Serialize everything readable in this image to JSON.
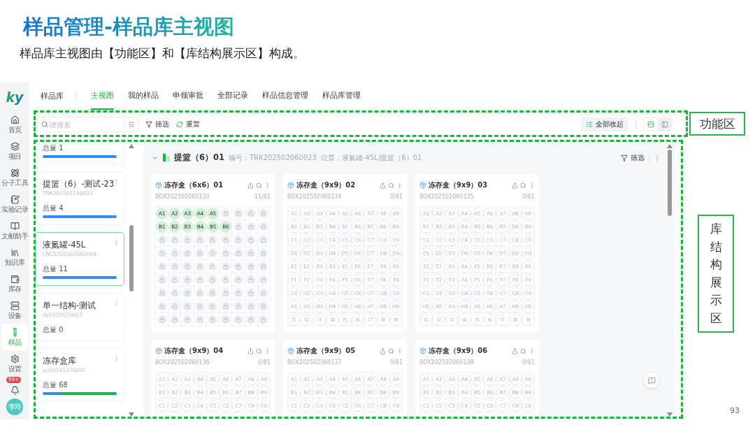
{
  "slide": {
    "title": "样品管理-样品库主视图",
    "subtitle": "样品库主视图由【功能区】和【库结构展示区】构成。",
    "page_number": "93"
  },
  "annotations": [
    {
      "label": "功能区",
      "kind": "horizontal"
    },
    {
      "label": "库结构展示区",
      "kind": "vertical"
    }
  ],
  "nav": {
    "logo": "ky",
    "items": [
      {
        "label": "首页",
        "selected": false
      },
      {
        "label": "项目",
        "selected": false
      },
      {
        "label": "分子工具",
        "selected": false
      },
      {
        "label": "实验记录",
        "selected": false
      },
      {
        "label": "文献助手",
        "selected": false
      },
      {
        "label": "知识库",
        "selected": false
      },
      {
        "label": "库存",
        "selected": false
      },
      {
        "label": "设备",
        "selected": false
      },
      {
        "label": "样品",
        "selected": true
      },
      {
        "label": "设置",
        "selected": false
      }
    ],
    "notification_badge": "99+",
    "avatar": "李玲"
  },
  "module_title": "样品库",
  "tabs": [
    {
      "label": "主视图",
      "selected": true
    },
    {
      "label": "我的样品",
      "selected": false
    },
    {
      "label": "申领审批",
      "selected": false
    },
    {
      "label": "全部记录",
      "selected": false
    },
    {
      "label": "样品信息管理",
      "selected": false
    },
    {
      "label": "样品库管理",
      "selected": false
    }
  ],
  "toolbar": {
    "search_placeholder": "请搜索",
    "filter": "筛选",
    "reset": "重置",
    "collapse_all": "全部收起",
    "views": [
      {
        "selected": true
      },
      {
        "selected": false
      }
    ]
  },
  "library_list": [
    {
      "total": "总量 1",
      "selected": false,
      "segments": [
        {
          "level": 1,
          "color": "#2f8ef5"
        }
      ]
    },
    {
      "name": "提篮（6）-测试-23",
      "code": "TRK202501230022",
      "total": "总量 4",
      "selected": false,
      "segments": [
        {
          "level": 1,
          "color": "#2f8ef5"
        }
      ]
    },
    {
      "name": "液氮罐-45L",
      "code": "LNCS202502060004",
      "total": "总量 11",
      "selected": true,
      "segments": [
        {
          "level": 1,
          "color": "#2f8ef5"
        }
      ]
    },
    {
      "name": "单一结构-测试",
      "code": "dy2025020615",
      "total": "总量 0",
      "selected": false
    },
    {
      "name": "冻存盒库",
      "code": "yp20241226002",
      "total": "总量 68",
      "selected": false,
      "segments": [
        {
          "level": 0.25,
          "color": "#2f8ef5"
        },
        {
          "level": 0.75,
          "color": "#1db34a"
        }
      ]
    }
  ],
  "basket": {
    "expanded": true,
    "title": "提篮（6）01",
    "code": "编号：TRK202502060023",
    "location": "位置：液氮罐-45L/提篮（6）01",
    "filter": "筛选"
  },
  "boxes": [
    {
      "title": "冻存盒（6x6）01",
      "code": "BOX202502060133",
      "count": "11/81",
      "rows": [
        [
          {
            "label": "A1",
            "kind": "occupied"
          },
          {
            "label": "A2",
            "kind": "occupied"
          },
          {
            "label": "A3",
            "kind": "occupied"
          },
          {
            "label": "A4",
            "kind": "occupied"
          },
          {
            "label": "A5",
            "kind": "occupied"
          },
          {
            "kind": "locked"
          },
          {
            "kind": "locked"
          },
          {
            "kind": "locked"
          },
          {
            "kind": "locked"
          }
        ],
        [
          {
            "label": "B1",
            "kind": "occupied"
          },
          {
            "label": "B2",
            "kind": "occupied"
          },
          {
            "label": "B3",
            "kind": "occupied"
          },
          {
            "label": "B4",
            "kind": "occupied"
          },
          {
            "label": "B5",
            "kind": "occupied"
          },
          {
            "label": "B6",
            "kind": "occupied"
          },
          {
            "kind": "locked"
          },
          {
            "kind": "locked"
          },
          {
            "kind": "locked"
          }
        ],
        [
          {
            "kind": "locked"
          },
          {
            "kind": "locked"
          },
          {
            "kind": "locked"
          },
          {
            "kind": "locked"
          },
          {
            "kind": "locked"
          },
          {
            "kind": "locked"
          },
          {
            "kind": "locked"
          },
          {
            "kind": "locked"
          },
          {
            "kind": "locked"
          }
        ],
        [
          {
            "kind": "locked"
          },
          {
            "kind": "locked"
          },
          {
            "kind": "locked"
          },
          {
            "kind": "locked"
          },
          {
            "kind": "locked"
          },
          {
            "kind": "locked"
          },
          {
            "kind": "locked"
          },
          {
            "kind": "locked"
          },
          {
            "kind": "locked"
          }
        ],
        [
          {
            "kind": "locked"
          },
          {
            "kind": "locked"
          },
          {
            "kind": "locked"
          },
          {
            "kind": "locked"
          },
          {
            "kind": "locked"
          },
          {
            "kind": "locked"
          },
          {
            "kind": "locked"
          },
          {
            "kind": "locked"
          },
          {
            "kind": "locked"
          }
        ],
        [
          {
            "kind": "locked"
          },
          {
            "kind": "locked"
          },
          {
            "kind": "locked"
          },
          {
            "kind": "locked"
          },
          {
            "kind": "locked"
          },
          {
            "kind": "locked"
          },
          {
            "kind": "locked"
          },
          {
            "kind": "locked"
          },
          {
            "kind": "locked"
          }
        ],
        [
          {
            "kind": "locked"
          },
          {
            "kind": "locked"
          },
          {
            "kind": "locked"
          },
          {
            "kind": "locked"
          },
          {
            "kind": "locked"
          },
          {
            "kind": "locked"
          },
          {
            "kind": "locked"
          },
          {
            "kind": "locked"
          },
          {
            "kind": "locked"
          }
        ],
        [
          {
            "kind": "locked"
          },
          {
            "kind": "locked"
          },
          {
            "kind": "locked"
          },
          {
            "kind": "locked"
          },
          {
            "kind": "locked"
          },
          {
            "kind": "locked"
          },
          {
            "kind": "locked"
          },
          {
            "kind": "locked"
          },
          {
            "kind": "locked"
          }
        ],
        [
          {
            "kind": "locked"
          },
          {
            "kind": "locked"
          },
          {
            "kind": "locked"
          },
          {
            "kind": "locked"
          },
          {
            "kind": "locked"
          },
          {
            "kind": "locked"
          },
          {
            "kind": "locked"
          },
          {
            "kind": "locked"
          },
          {
            "kind": "locked"
          }
        ]
      ]
    },
    {
      "title": "冻存盒（9x9）02",
      "code": "BOX202502060134",
      "count": "0/81",
      "rows": [
        [
          {
            "label": "A1",
            "kind": "empty"
          },
          {
            "label": "A2",
            "kind": "empty"
          },
          {
            "label": "A3",
            "kind": "empty"
          },
          {
            "label": "A4",
            "kind": "empty"
          },
          {
            "label": "A5",
            "kind": "empty"
          },
          {
            "label": "A6",
            "kind": "empty"
          },
          {
            "label": "A7",
            "kind": "empty"
          },
          {
            "label": "A8",
            "kind": "empty"
          },
          {
            "label": "A9",
            "kind": "empty"
          }
        ],
        [
          {
            "label": "B1",
            "kind": "empty"
          },
          {
            "label": "B2",
            "kind": "empty"
          },
          {
            "label": "B3",
            "kind": "empty"
          },
          {
            "label": "B4",
            "kind": "empty"
          },
          {
            "label": "B5",
            "kind": "empty"
          },
          {
            "label": "B6",
            "kind": "empty"
          },
          {
            "label": "B7",
            "kind": "empty"
          },
          {
            "label": "B8",
            "kind": "empty"
          },
          {
            "label": "B9",
            "kind": "empty"
          }
        ],
        [
          {
            "label": "C1",
            "kind": "empty"
          },
          {
            "label": "C2",
            "kind": "empty"
          },
          {
            "label": "C3",
            "kind": "empty"
          },
          {
            "label": "C4",
            "kind": "empty"
          },
          {
            "label": "C5",
            "kind": "empty"
          },
          {
            "label": "C6",
            "kind": "empty"
          },
          {
            "label": "C7",
            "kind": "empty"
          },
          {
            "label": "C8",
            "kind": "empty"
          },
          {
            "label": "C9",
            "kind": "empty"
          }
        ],
        [
          {
            "label": "D1",
            "kind": "empty"
          },
          {
            "label": "D2",
            "kind": "empty"
          },
          {
            "label": "D3",
            "kind": "empty"
          },
          {
            "label": "D4",
            "kind": "empty"
          },
          {
            "label": "D5",
            "kind": "empty"
          },
          {
            "label": "D6",
            "kind": "empty"
          },
          {
            "label": "D7",
            "kind": "empty"
          },
          {
            "label": "D8",
            "kind": "empty"
          },
          {
            "label": "D9",
            "kind": "empty"
          }
        ],
        [
          {
            "label": "E1",
            "kind": "empty"
          },
          {
            "label": "E2",
            "kind": "empty"
          },
          {
            "label": "E3",
            "kind": "empty"
          },
          {
            "label": "E4",
            "kind": "empty"
          },
          {
            "label": "E5",
            "kind": "empty"
          },
          {
            "label": "E6",
            "kind": "empty"
          },
          {
            "label": "E7",
            "kind": "empty"
          },
          {
            "label": "E8",
            "kind": "empty"
          },
          {
            "label": "E9",
            "kind": "empty"
          }
        ],
        [
          {
            "label": "F1",
            "kind": "empty"
          },
          {
            "label": "F2",
            "kind": "empty"
          },
          {
            "label": "F3",
            "kind": "empty"
          },
          {
            "label": "F4",
            "kind": "empty"
          },
          {
            "label": "F5",
            "kind": "empty"
          },
          {
            "label": "F6",
            "kind": "empty"
          },
          {
            "label": "F7",
            "kind": "empty"
          },
          {
            "label": "F8",
            "kind": "empty"
          },
          {
            "label": "F9",
            "kind": "empty"
          }
        ],
        [
          {
            "label": "G1",
            "kind": "empty"
          },
          {
            "label": "G2",
            "kind": "empty"
          },
          {
            "label": "G3",
            "kind": "empty"
          },
          {
            "label": "G4",
            "kind": "empty"
          },
          {
            "label": "G5",
            "kind": "empty"
          },
          {
            "label": "G6",
            "kind": "empty"
          },
          {
            "label": "G7",
            "kind": "empty"
          },
          {
            "label": "G8",
            "kind": "empty"
          },
          {
            "label": "G9",
            "kind": "empty"
          }
        ],
        [
          {
            "label": "H1",
            "kind": "empty"
          },
          {
            "label": "H2",
            "kind": "empty"
          },
          {
            "label": "H3",
            "kind": "empty"
          },
          {
            "label": "H4",
            "kind": "empty"
          },
          {
            "label": "H5",
            "kind": "empty"
          },
          {
            "label": "H6",
            "kind": "empty"
          },
          {
            "label": "H7",
            "kind": "empty"
          },
          {
            "label": "H8",
            "kind": "empty"
          },
          {
            "label": "H9",
            "kind": "empty"
          }
        ],
        [
          {
            "label": "I1",
            "kind": "empty"
          },
          {
            "label": "I2",
            "kind": "empty"
          },
          {
            "label": "I3",
            "kind": "empty"
          },
          {
            "label": "I4",
            "kind": "empty"
          },
          {
            "label": "I5",
            "kind": "empty"
          },
          {
            "label": "I6",
            "kind": "empty"
          },
          {
            "label": "I7",
            "kind": "empty"
          },
          {
            "label": "I8",
            "kind": "empty"
          },
          {
            "label": "I9",
            "kind": "empty"
          }
        ]
      ]
    },
    {
      "title": "冻存盒（9x9）03",
      "code": "BOX202502060135",
      "count": "0/81",
      "rows": [
        [
          {
            "label": "A1",
            "kind": "empty"
          },
          {
            "label": "A2",
            "kind": "empty"
          },
          {
            "label": "A3",
            "kind": "empty"
          },
          {
            "label": "A4",
            "kind": "empty"
          },
          {
            "label": "A5",
            "kind": "empty"
          },
          {
            "label": "A6",
            "kind": "empty"
          },
          {
            "label": "A7",
            "kind": "empty"
          },
          {
            "label": "A8",
            "kind": "empty"
          },
          {
            "label": "A9",
            "kind": "empty"
          }
        ],
        [
          {
            "label": "B1",
            "kind": "empty"
          },
          {
            "label": "B2",
            "kind": "empty"
          },
          {
            "label": "B3",
            "kind": "empty"
          },
          {
            "label": "B4",
            "kind": "empty"
          },
          {
            "label": "B5",
            "kind": "empty"
          },
          {
            "label": "B6",
            "kind": "empty"
          },
          {
            "label": "B7",
            "kind": "empty"
          },
          {
            "label": "B8",
            "kind": "empty"
          },
          {
            "label": "B9",
            "kind": "empty"
          }
        ],
        [
          {
            "label": "C1",
            "kind": "empty"
          },
          {
            "label": "C2",
            "kind": "empty"
          },
          {
            "label": "C3",
            "kind": "empty"
          },
          {
            "label": "C4",
            "kind": "empty"
          },
          {
            "label": "C5",
            "kind": "empty"
          },
          {
            "label": "C6",
            "kind": "empty"
          },
          {
            "label": "C7",
            "kind": "empty"
          },
          {
            "label": "C8",
            "kind": "empty"
          },
          {
            "label": "C9",
            "kind": "empty"
          }
        ],
        [
          {
            "label": "D1",
            "kind": "empty"
          },
          {
            "label": "D2",
            "kind": "empty"
          },
          {
            "label": "D3",
            "kind": "empty"
          },
          {
            "label": "D4",
            "kind": "empty"
          },
          {
            "label": "D5",
            "kind": "empty"
          },
          {
            "label": "D6",
            "kind": "empty"
          },
          {
            "label": "D7",
            "kind": "empty"
          },
          {
            "label": "D8",
            "kind": "empty"
          },
          {
            "label": "D9",
            "kind": "empty"
          }
        ],
        [
          {
            "label": "E1",
            "kind": "empty"
          },
          {
            "label": "E2",
            "kind": "empty"
          },
          {
            "label": "E3",
            "kind": "empty"
          },
          {
            "label": "E4",
            "kind": "empty"
          },
          {
            "label": "E5",
            "kind": "empty"
          },
          {
            "label": "E6",
            "kind": "empty"
          },
          {
            "label": "E7",
            "kind": "empty"
          },
          {
            "label": "E8",
            "kind": "empty"
          },
          {
            "label": "E9",
            "kind": "empty"
          }
        ],
        [
          {
            "label": "F1",
            "kind": "empty"
          },
          {
            "label": "F2",
            "kind": "empty"
          },
          {
            "label": "F3",
            "kind": "empty"
          },
          {
            "label": "F4",
            "kind": "empty"
          },
          {
            "label": "F5",
            "kind": "empty"
          },
          {
            "label": "F6",
            "kind": "empty"
          },
          {
            "label": "F7",
            "kind": "empty"
          },
          {
            "label": "F8",
            "kind": "empty"
          },
          {
            "label": "F9",
            "kind": "empty"
          }
        ],
        [
          {
            "label": "G1",
            "kind": "empty"
          },
          {
            "label": "G2",
            "kind": "empty"
          },
          {
            "label": "G3",
            "kind": "empty"
          },
          {
            "label": "G4",
            "kind": "empty"
          },
          {
            "label": "G5",
            "kind": "empty"
          },
          {
            "label": "G6",
            "kind": "empty"
          },
          {
            "label": "G7",
            "kind": "empty"
          },
          {
            "label": "G8",
            "kind": "empty"
          },
          {
            "label": "G9",
            "kind": "empty"
          }
        ],
        [
          {
            "label": "H1",
            "kind": "empty"
          },
          {
            "label": "H2",
            "kind": "empty"
          },
          {
            "label": "H3",
            "kind": "empty"
          },
          {
            "label": "H4",
            "kind": "empty"
          },
          {
            "label": "H5",
            "kind": "empty"
          },
          {
            "label": "H6",
            "kind": "empty"
          },
          {
            "label": "H7",
            "kind": "empty"
          },
          {
            "label": "H8",
            "kind": "empty"
          },
          {
            "label": "H9",
            "kind": "empty"
          }
        ],
        [
          {
            "label": "I1",
            "kind": "empty"
          },
          {
            "label": "I2",
            "kind": "empty"
          },
          {
            "label": "I3",
            "kind": "empty"
          },
          {
            "label": "I4",
            "kind": "empty"
          },
          {
            "label": "I5",
            "kind": "empty"
          },
          {
            "label": "I6",
            "kind": "empty"
          },
          {
            "label": "I7",
            "kind": "empty"
          },
          {
            "label": "I8",
            "kind": "empty"
          },
          {
            "label": "I9",
            "kind": "empty"
          }
        ]
      ]
    },
    {
      "title": "冻存盒（9x9）04",
      "code": "BOX202502060136",
      "count": "0/81",
      "rows": [
        [
          {
            "label": "A1",
            "kind": "empty"
          },
          {
            "label": "A2",
            "kind": "empty"
          },
          {
            "label": "A3",
            "kind": "empty"
          },
          {
            "label": "A4",
            "kind": "empty"
          },
          {
            "label": "A5",
            "kind": "empty"
          },
          {
            "label": "A6",
            "kind": "empty"
          },
          {
            "label": "A7",
            "kind": "empty"
          },
          {
            "label": "A8",
            "kind": "empty"
          },
          {
            "label": "A9",
            "kind": "empty"
          }
        ],
        [
          {
            "label": "B1",
            "kind": "empty"
          },
          {
            "label": "B2",
            "kind": "empty"
          },
          {
            "label": "B3",
            "kind": "empty"
          },
          {
            "label": "B4",
            "kind": "empty"
          },
          {
            "label": "B5",
            "kind": "empty"
          },
          {
            "label": "B6",
            "kind": "empty"
          },
          {
            "label": "B7",
            "kind": "empty"
          },
          {
            "label": "B8",
            "kind": "empty"
          },
          {
            "label": "B9",
            "kind": "empty"
          }
        ],
        [
          {
            "label": "C1",
            "kind": "empty"
          },
          {
            "label": "C2",
            "kind": "empty"
          },
          {
            "label": "C3",
            "kind": "empty"
          },
          {
            "label": "C4",
            "kind": "empty"
          },
          {
            "label": "C5",
            "kind": "empty"
          },
          {
            "label": "C6",
            "kind": "empty"
          },
          {
            "label": "C7",
            "kind": "empty"
          },
          {
            "label": "C8",
            "kind": "empty"
          },
          {
            "label": "C9",
            "kind": "empty"
          }
        ]
      ]
    },
    {
      "title": "冻存盒（9x9）05",
      "code": "BOX202502060137",
      "count": "0/81",
      "rows": [
        [
          {
            "label": "A1",
            "kind": "empty"
          },
          {
            "label": "A2",
            "kind": "empty"
          },
          {
            "label": "A3",
            "kind": "empty"
          },
          {
            "label": "A4",
            "kind": "empty"
          },
          {
            "label": "A5",
            "kind": "empty"
          },
          {
            "label": "A6",
            "kind": "empty"
          },
          {
            "label": "A7",
            "kind": "empty"
          },
          {
            "label": "A8",
            "kind": "empty"
          },
          {
            "label": "A9",
            "kind": "empty"
          }
        ],
        [
          {
            "label": "B1",
            "kind": "empty"
          },
          {
            "label": "B2",
            "kind": "empty"
          },
          {
            "label": "B3",
            "kind": "empty"
          },
          {
            "label": "B4",
            "kind": "empty"
          },
          {
            "label": "B5",
            "kind": "empty"
          },
          {
            "label": "B6",
            "kind": "empty"
          },
          {
            "label": "B7",
            "kind": "empty"
          },
          {
            "label": "B8",
            "kind": "empty"
          },
          {
            "label": "B9",
            "kind": "empty"
          }
        ],
        [
          {
            "label": "C1",
            "kind": "empty"
          },
          {
            "label": "C2",
            "kind": "empty"
          },
          {
            "label": "C3",
            "kind": "empty"
          },
          {
            "label": "C4",
            "kind": "empty"
          },
          {
            "label": "C5",
            "kind": "empty"
          },
          {
            "label": "C6",
            "kind": "empty"
          },
          {
            "label": "C7",
            "kind": "empty"
          },
          {
            "label": "C8",
            "kind": "empty"
          },
          {
            "label": "C9",
            "kind": "empty"
          }
        ]
      ]
    },
    {
      "title": "冻存盒（9x9）06",
      "code": "BOX202502060138",
      "count": "0/81",
      "rows": [
        [
          {
            "label": "A1",
            "kind": "empty"
          },
          {
            "label": "A2",
            "kind": "empty"
          },
          {
            "label": "A3",
            "kind": "empty"
          },
          {
            "label": "A4",
            "kind": "empty"
          },
          {
            "label": "A5",
            "kind": "empty"
          },
          {
            "label": "A6",
            "kind": "empty"
          },
          {
            "label": "A7",
            "kind": "empty"
          },
          {
            "label": "A8",
            "kind": "empty"
          },
          {
            "label": "A9",
            "kind": "empty"
          }
        ],
        [
          {
            "label": "B1",
            "kind": "empty"
          },
          {
            "label": "B2",
            "kind": "empty"
          },
          {
            "label": "B3",
            "kind": "empty"
          },
          {
            "label": "B4",
            "kind": "empty"
          },
          {
            "label": "B5",
            "kind": "empty"
          },
          {
            "label": "B6",
            "kind": "empty"
          },
          {
            "label": "B7",
            "kind": "empty"
          },
          {
            "label": "B8",
            "kind": "empty"
          },
          {
            "label": "B9",
            "kind": "empty"
          }
        ],
        [
          {
            "label": "C1",
            "kind": "empty"
          },
          {
            "label": "C2",
            "kind": "empty"
          },
          {
            "label": "C3",
            "kind": "empty"
          },
          {
            "label": "C4",
            "kind": "empty"
          },
          {
            "label": "C5",
            "kind": "empty"
          },
          {
            "label": "C6",
            "kind": "empty"
          },
          {
            "label": "C7",
            "kind": "empty"
          },
          {
            "label": "C8",
            "kind": "empty"
          },
          {
            "label": "C9",
            "kind": "empty"
          }
        ]
      ]
    }
  ]
}
